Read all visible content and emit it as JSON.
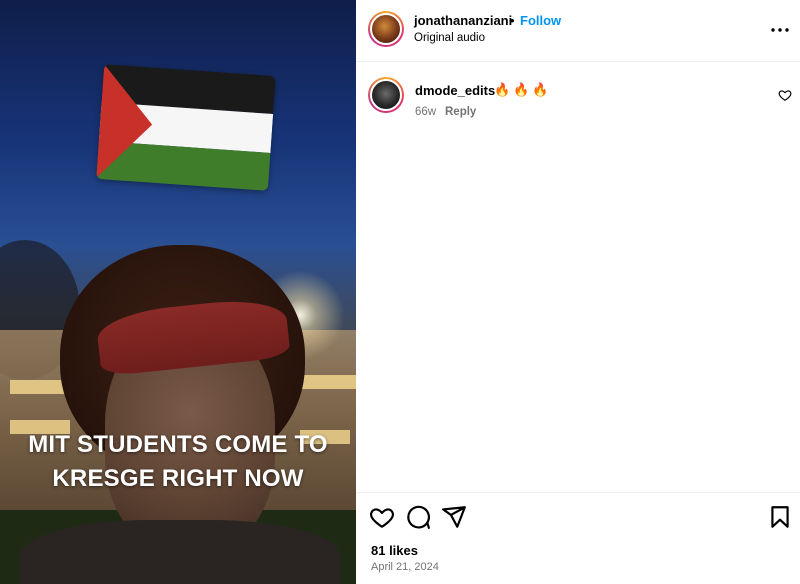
{
  "media": {
    "caption_line1": "MIT STUDENTS COME TO",
    "caption_line2": "KRESGE RIGHT NOW"
  },
  "post": {
    "username": "jonathananziani",
    "separator": "•",
    "follow_label": "Follow",
    "audio_label": "Original audio",
    "more_icon": "more-options-icon"
  },
  "comments": [
    {
      "username": "dmode_edits",
      "text": "🔥🔥🔥",
      "age": "66w",
      "reply_label": "Reply",
      "like_icon": "heart-icon"
    }
  ],
  "actions": {
    "icons": [
      "heart-icon",
      "comment-icon",
      "share-icon",
      "bookmark-icon"
    ]
  },
  "stats": {
    "likes": "81 likes",
    "date": "April 21, 2024"
  },
  "colors": {
    "accent": "#0095f6",
    "muted": "#737373",
    "divider": "#efefef"
  }
}
